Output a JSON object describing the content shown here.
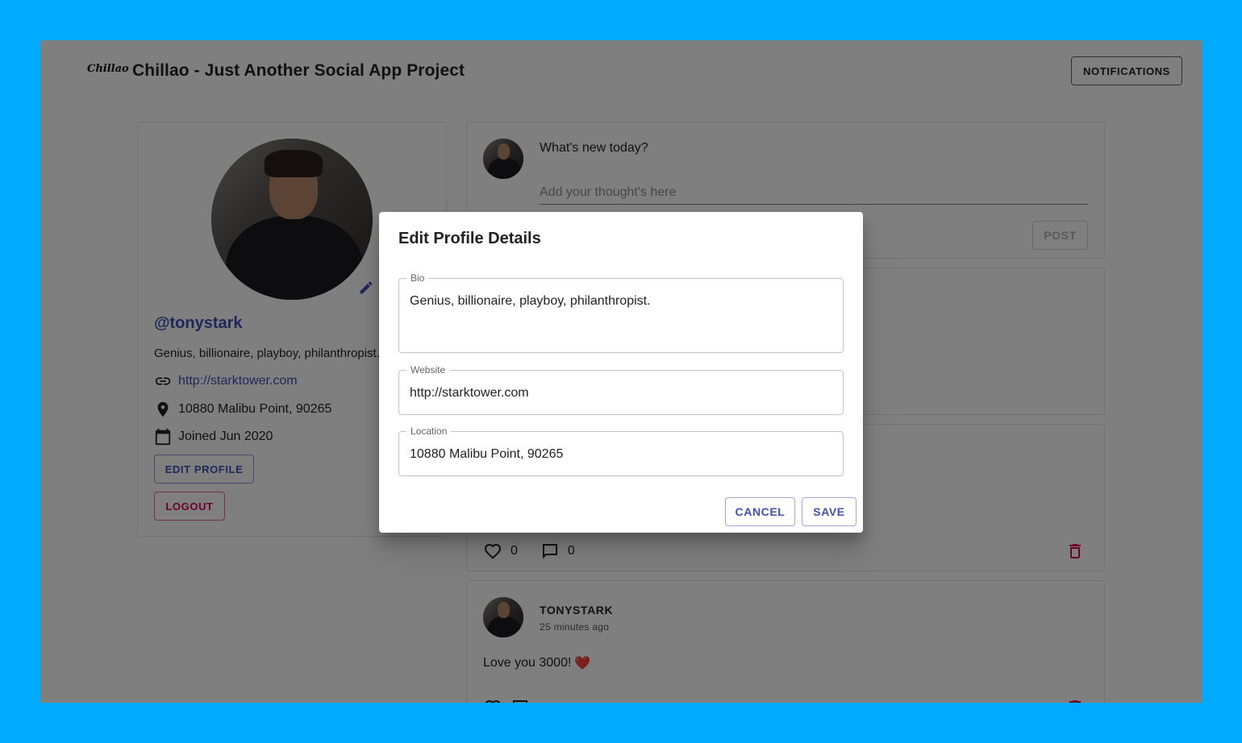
{
  "header": {
    "logo": "Chillao",
    "title": "Chillao - Just Another Social App Project",
    "notifications_label": "NOTIFICATIONS"
  },
  "profile": {
    "username": "@tonystark",
    "bio": "Genius, billionaire, playboy, philanthropist.",
    "website": "http://starktower.com",
    "location": "10880 Malibu Point, 90265",
    "joined": "Joined Jun 2020",
    "edit_label": "EDIT PROFILE",
    "logout_label": "LOGOUT"
  },
  "compose": {
    "prompt": "What's new today?",
    "placeholder": "Add your thought's here",
    "post_label": "POST"
  },
  "posts": [
    {
      "likes": "0",
      "comments": "0"
    },
    {
      "author": "TONYSTARK",
      "time": "25 minutes ago",
      "body": "Love you 3000!",
      "emoji": "❤️"
    }
  ],
  "dialog": {
    "title": "Edit Profile Details",
    "bio_label": "Bio",
    "bio_value": "Genius, billionaire, playboy, philanthropist.",
    "website_label": "Website",
    "website_value": "http://starktower.com",
    "location_label": "Location",
    "location_value": "10880 Malibu Point, 90265",
    "cancel_label": "CANCEL",
    "save_label": "SAVE"
  },
  "colors": {
    "page_background": "#00aaff",
    "primary": "#3f51b5",
    "secondary": "#dc004e",
    "overlay": "rgba(0,0,0,0.5)"
  }
}
